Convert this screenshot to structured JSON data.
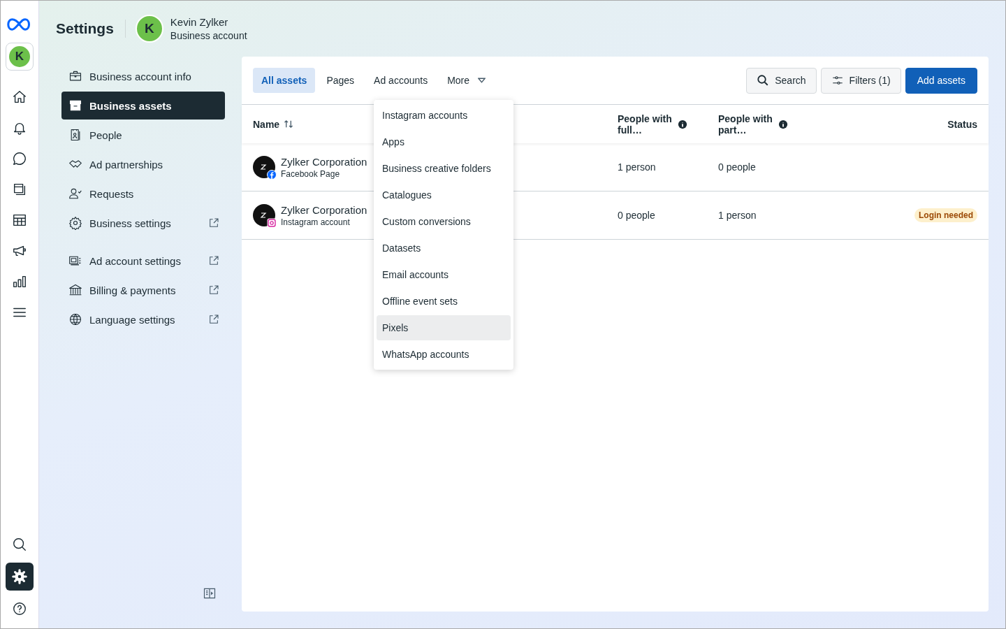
{
  "header": {
    "title": "Settings",
    "account": {
      "initial": "K",
      "name": "Kevin Zylker",
      "subtitle": "Business account"
    }
  },
  "rail": {
    "avatar": "K",
    "items": [
      {
        "kind": "home",
        "selected": false
      },
      {
        "kind": "bell",
        "selected": false
      },
      {
        "kind": "chat",
        "selected": false
      },
      {
        "kind": "pages",
        "selected": false
      },
      {
        "kind": "table",
        "selected": false
      },
      {
        "kind": "megaphone",
        "selected": false
      },
      {
        "kind": "chart",
        "selected": false
      },
      {
        "kind": "menu",
        "selected": false
      }
    ],
    "bottom": [
      {
        "kind": "search",
        "selected": false
      },
      {
        "kind": "settings",
        "selected": true
      },
      {
        "kind": "help",
        "selected": false
      }
    ]
  },
  "sidebar": {
    "groups": [
      [
        {
          "label": "Business account info",
          "selected": false,
          "external": false
        },
        {
          "label": "Business assets",
          "selected": true,
          "external": false
        },
        {
          "label": "People",
          "selected": false,
          "external": false
        },
        {
          "label": "Ad partnerships",
          "selected": false,
          "external": false
        },
        {
          "label": "Requests",
          "selected": false,
          "external": false
        },
        {
          "label": "Business settings",
          "selected": false,
          "external": true
        }
      ],
      [
        {
          "label": "Ad account settings",
          "selected": false,
          "external": true
        },
        {
          "label": "Billing & payments",
          "selected": false,
          "external": true
        },
        {
          "label": "Language settings",
          "selected": false,
          "external": true
        }
      ]
    ]
  },
  "tabs": [
    {
      "label": "All assets",
      "selected": true,
      "kind": "tab"
    },
    {
      "label": "Pages",
      "selected": false,
      "kind": "tab"
    },
    {
      "label": "Ad accounts",
      "selected": false,
      "kind": "tab"
    },
    {
      "label": "More",
      "selected": false,
      "kind": "dropdown"
    }
  ],
  "toolbar": [
    {
      "label": "Search",
      "kind": "search"
    },
    {
      "label": "Filters (1)",
      "kind": "filter"
    },
    {
      "label": "Add assets",
      "kind": "primary"
    }
  ],
  "table": {
    "columns": [
      {
        "label": "Name",
        "kind": "sort"
      },
      {
        "label": "People with full…",
        "kind": "info"
      },
      {
        "label": "People with part…",
        "kind": "info"
      },
      {
        "label": "Status",
        "kind": "plain"
      }
    ],
    "rows": [
      {
        "name": "Zylker Corporation",
        "type": "Facebook Page",
        "kind": "facebook",
        "full": "1 person",
        "partial": "0 people"
      },
      {
        "name": "Zylker Corporation",
        "type": "Instagram account",
        "kind": "instagram",
        "full": "0 people",
        "partial": "1 person",
        "status": "Login needed"
      }
    ]
  },
  "more_menu": {
    "items": [
      {
        "label": "Instagram accounts",
        "selected": false
      },
      {
        "label": "Apps",
        "selected": false
      },
      {
        "label": "Business creative folders",
        "selected": false
      },
      {
        "label": "Catalogues",
        "selected": false
      },
      {
        "label": "Custom conversions",
        "selected": false
      },
      {
        "label": "Datasets",
        "selected": false
      },
      {
        "label": "Email accounts",
        "selected": false
      },
      {
        "label": "Offline event sets",
        "selected": false
      },
      {
        "label": "Pixels",
        "selected": true
      },
      {
        "label": "WhatsApp accounts",
        "selected": false
      }
    ]
  }
}
